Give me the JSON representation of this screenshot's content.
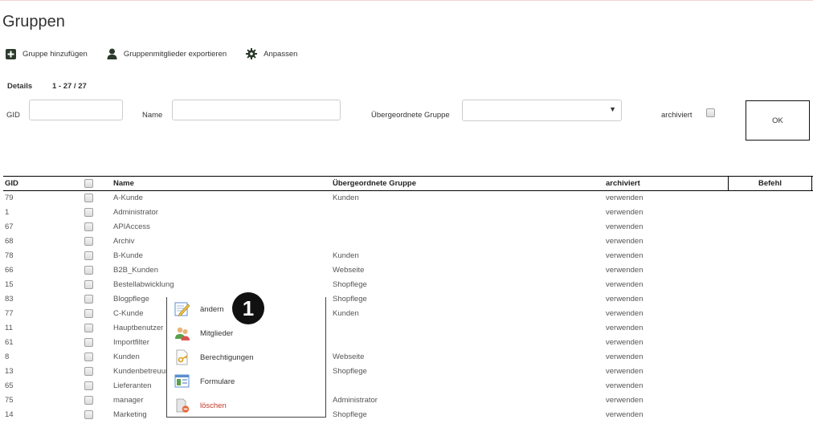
{
  "page": {
    "title": "Gruppen"
  },
  "toolbar": {
    "add_group": "Gruppe hinzufügen",
    "export_members": "Gruppenmitglieder exportieren",
    "customize": "Anpassen"
  },
  "summary": {
    "details": "Details",
    "range": "1 - 27 / 27"
  },
  "filters": {
    "gid_label": "GID",
    "gid_value": "",
    "name_label": "Name",
    "name_value": "",
    "parent_label": "Übergeordnete Gruppe",
    "parent_value": "",
    "archived_label": "archiviert",
    "ok_label": "OK"
  },
  "table": {
    "headers": {
      "gid": "GID",
      "name": "Name",
      "parent": "Übergeordnete Gruppe",
      "archived": "archiviert",
      "command": "Befehl"
    },
    "rows": [
      {
        "gid": "79",
        "name": "A-Kunde",
        "parent": "Kunden",
        "archived": "verwenden"
      },
      {
        "gid": "1",
        "name": "Administrator",
        "parent": "",
        "archived": "verwenden"
      },
      {
        "gid": "67",
        "name": "APIAccess",
        "parent": "",
        "archived": "verwenden"
      },
      {
        "gid": "68",
        "name": "Archiv",
        "parent": "",
        "archived": "verwenden"
      },
      {
        "gid": "78",
        "name": "B-Kunde",
        "parent": "Kunden",
        "archived": "verwenden"
      },
      {
        "gid": "66",
        "name": "B2B_Kunden",
        "parent": "Webseite",
        "archived": "verwenden"
      },
      {
        "gid": "15",
        "name": "Bestellabwicklung",
        "parent": "Shopflege",
        "archived": "verwenden"
      },
      {
        "gid": "83",
        "name": "Blogpflege",
        "parent": "Shopflege",
        "archived": "verwenden"
      },
      {
        "gid": "77",
        "name": "C-Kunde",
        "parent": "Kunden",
        "archived": "verwenden"
      },
      {
        "gid": "11",
        "name": "Hauptbenutzer",
        "parent": "",
        "archived": "verwenden"
      },
      {
        "gid": "61",
        "name": "Importfilter",
        "parent": "",
        "archived": "verwenden"
      },
      {
        "gid": "8",
        "name": "Kunden",
        "parent": "Webseite",
        "archived": "verwenden"
      },
      {
        "gid": "13",
        "name": "Kundenbetreuung",
        "parent": "Shopflege",
        "archived": "verwenden"
      },
      {
        "gid": "65",
        "name": "Lieferanten",
        "parent": "",
        "archived": "verwenden"
      },
      {
        "gid": "75",
        "name": "manager",
        "parent": "Administrator",
        "archived": "verwenden"
      },
      {
        "gid": "14",
        "name": "Marketing",
        "parent": "Shopflege",
        "archived": "verwenden"
      }
    ]
  },
  "context_menu": {
    "items": [
      {
        "label": "ändern",
        "icon": "pencil-edit-icon"
      },
      {
        "label": "Mitglieder",
        "icon": "users-icon"
      },
      {
        "label": "Berechtigungen",
        "icon": "key-document-icon"
      },
      {
        "label": "Formulare",
        "icon": "form-icon"
      },
      {
        "label": "löschen",
        "icon": "delete-icon"
      }
    ]
  },
  "callout": {
    "number": "1"
  },
  "colors": {
    "toolbar_icon": "#2b3a2b",
    "danger": "#c0392b",
    "text": "#333333"
  }
}
